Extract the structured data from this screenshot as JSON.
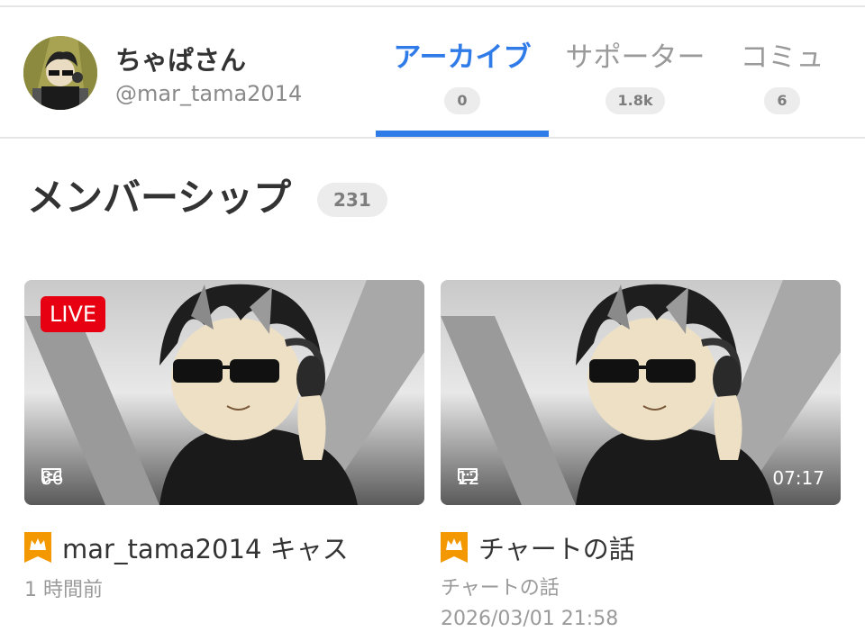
{
  "profile": {
    "name": "ちゃぱさん",
    "handle": "@mar_tama2014"
  },
  "tabs": [
    {
      "label": "アーカイブ",
      "count": "0",
      "active": true
    },
    {
      "label": "サポーター",
      "count": "1.8k",
      "active": false
    },
    {
      "label": "コミュ",
      "count": "6",
      "active": false
    }
  ],
  "section": {
    "title": "メンバーシップ",
    "count": "231"
  },
  "cards": [
    {
      "badge": "LIVE",
      "comment_count": "86",
      "duration": "",
      "title": "mar_tama2014 キャス",
      "subtitle": "1 時間前",
      "date": ""
    },
    {
      "badge": "",
      "comment_count": "12",
      "duration": "07:17",
      "title": "チャートの話",
      "subtitle": "チャートの話",
      "date": "2026/03/01 21:58"
    }
  ],
  "colors": {
    "accent": "#2f7be8",
    "live": "#e60012",
    "crown": "#f39800"
  },
  "icons": [
    "comment-icon",
    "crown-icon"
  ]
}
